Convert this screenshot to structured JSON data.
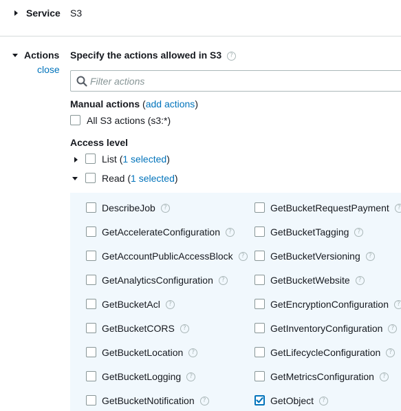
{
  "service": {
    "label": "Service",
    "value": "S3"
  },
  "actions": {
    "label": "Actions",
    "close_label": "close",
    "heading": "Specify the actions allowed in S3",
    "filter_placeholder": "Filter actions",
    "manual": {
      "title": "Manual actions",
      "open_paren": "(",
      "add_link": "add actions",
      "close_paren": ")",
      "all_label": "All S3 actions (s3:*)"
    },
    "access_level": {
      "title": "Access level",
      "list": {
        "name": "List",
        "open_paren": "(",
        "selected": "1 selected",
        "close_paren": ")",
        "expanded": false
      },
      "read": {
        "name": "Read",
        "open_paren": "(",
        "selected": "1 selected",
        "close_paren": ")",
        "expanded": true
      }
    },
    "read_items_left": [
      {
        "label": "DescribeJob",
        "checked": false
      },
      {
        "label": "GetAccelerateConfiguration",
        "checked": false
      },
      {
        "label": "GetAccountPublicAccessBlock",
        "checked": false
      },
      {
        "label": "GetAnalyticsConfiguration",
        "checked": false
      },
      {
        "label": "GetBucketAcl",
        "checked": false
      },
      {
        "label": "GetBucketCORS",
        "checked": false
      },
      {
        "label": "GetBucketLocation",
        "checked": false
      },
      {
        "label": "GetBucketLogging",
        "checked": false
      },
      {
        "label": "GetBucketNotification",
        "checked": false
      }
    ],
    "read_items_right": [
      {
        "label": "GetBucketRequestPayment",
        "checked": false
      },
      {
        "label": "GetBucketTagging",
        "checked": false
      },
      {
        "label": "GetBucketVersioning",
        "checked": false
      },
      {
        "label": "GetBucketWebsite",
        "checked": false
      },
      {
        "label": "GetEncryptionConfiguration",
        "checked": false
      },
      {
        "label": "GetInventoryConfiguration",
        "checked": false
      },
      {
        "label": "GetLifecycleConfiguration",
        "checked": false
      },
      {
        "label": "GetMetricsConfiguration",
        "checked": false
      },
      {
        "label": "GetObject",
        "checked": true
      }
    ],
    "help_glyph": "?"
  },
  "colors": {
    "link": "#0073bb",
    "panel_bg": "#f1f8fd",
    "divider": "#d5dbdb"
  }
}
